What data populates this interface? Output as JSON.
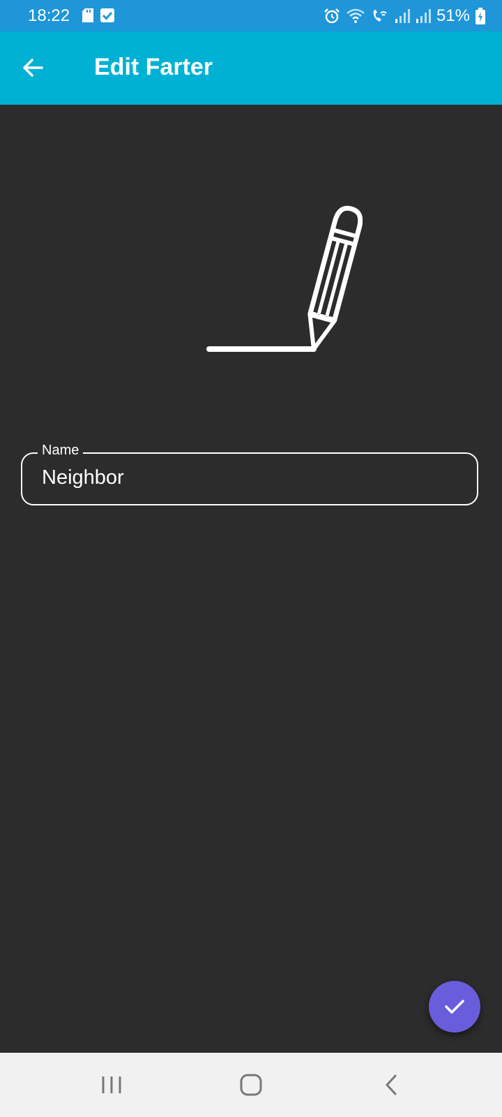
{
  "status_bar": {
    "time": "18:22",
    "battery_percent": "51%",
    "background_color": "#1e96d8",
    "left_icons": [
      "sd-card-icon",
      "checkbox-notification-icon"
    ],
    "right_icons": [
      "alarm-icon",
      "wifi-icon",
      "wifi-calling-icon",
      "signal-icon",
      "signal-icon",
      "battery-charging-icon"
    ]
  },
  "app_bar": {
    "title": "Edit Farter",
    "background_color": "#00b1d3",
    "back_icon": "arrow-left-icon"
  },
  "illustration": {
    "icon": "pencil-drawing-line-icon"
  },
  "form": {
    "name_label": "Name",
    "name_value": "Neighbor"
  },
  "fab": {
    "icon": "check-icon",
    "color": "#6a5ddb"
  },
  "nav_bar": {
    "buttons": [
      "recent-apps-icon",
      "home-icon",
      "back-icon"
    ]
  }
}
